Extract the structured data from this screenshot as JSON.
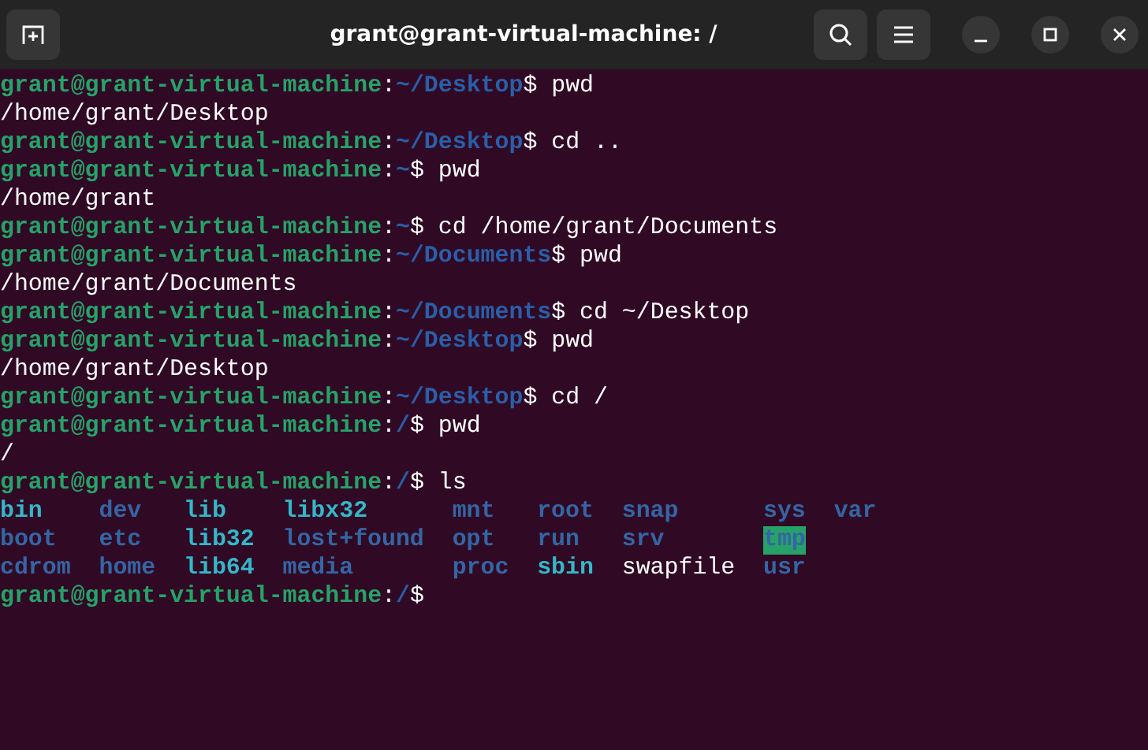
{
  "window": {
    "title": "grant@grant-virtual-machine: /"
  },
  "lines": [
    {
      "kind": "prompt",
      "user": "grant@grant-virtual-machine",
      "sep": ":",
      "path": "~/Desktop",
      "dollar": "$",
      "command": "pwd"
    },
    {
      "kind": "output",
      "text": "/home/grant/Desktop"
    },
    {
      "kind": "prompt",
      "user": "grant@grant-virtual-machine",
      "sep": ":",
      "path": "~/Desktop",
      "dollar": "$",
      "command": "cd .."
    },
    {
      "kind": "prompt",
      "user": "grant@grant-virtual-machine",
      "sep": ":",
      "path": "~",
      "dollar": "$",
      "command": "pwd"
    },
    {
      "kind": "output",
      "text": "/home/grant"
    },
    {
      "kind": "prompt",
      "user": "grant@grant-virtual-machine",
      "sep": ":",
      "path": "~",
      "dollar": "$",
      "command": "cd /home/grant/Documents"
    },
    {
      "kind": "prompt",
      "user": "grant@grant-virtual-machine",
      "sep": ":",
      "path": "~/Documents",
      "dollar": "$",
      "command": "pwd"
    },
    {
      "kind": "output",
      "text": "/home/grant/Documents"
    },
    {
      "kind": "prompt",
      "user": "grant@grant-virtual-machine",
      "sep": ":",
      "path": "~/Documents",
      "dollar": "$",
      "command": "cd ~/Desktop"
    },
    {
      "kind": "prompt",
      "user": "grant@grant-virtual-machine",
      "sep": ":",
      "path": "~/Desktop",
      "dollar": "$",
      "command": "pwd"
    },
    {
      "kind": "output",
      "text": "/home/grant/Desktop"
    },
    {
      "kind": "prompt",
      "user": "grant@grant-virtual-machine",
      "sep": ":",
      "path": "~/Desktop",
      "dollar": "$",
      "command": "cd /"
    },
    {
      "kind": "prompt",
      "user": "grant@grant-virtual-machine",
      "sep": ":",
      "path": "/",
      "dollar": "$",
      "command": "pwd"
    },
    {
      "kind": "output",
      "text": "/"
    },
    {
      "kind": "prompt",
      "user": "grant@grant-virtual-machine",
      "sep": ":",
      "path": "/",
      "dollar": "$",
      "command": "ls"
    },
    {
      "kind": "listing",
      "columns": [
        [
          {
            "name": "bin",
            "kind": "link"
          },
          {
            "name": "boot",
            "kind": "dir"
          },
          {
            "name": "cdrom",
            "kind": "dir"
          }
        ],
        [
          {
            "name": "dev",
            "kind": "dir"
          },
          {
            "name": "etc",
            "kind": "dir"
          },
          {
            "name": "home",
            "kind": "dir"
          }
        ],
        [
          {
            "name": "lib",
            "kind": "link"
          },
          {
            "name": "lib32",
            "kind": "link"
          },
          {
            "name": "lib64",
            "kind": "link"
          }
        ],
        [
          {
            "name": "libx32",
            "kind": "link"
          },
          {
            "name": "lost+found",
            "kind": "dir"
          },
          {
            "name": "media",
            "kind": "dir"
          }
        ],
        [
          {
            "name": "mnt",
            "kind": "dir"
          },
          {
            "name": "opt",
            "kind": "dir"
          },
          {
            "name": "proc",
            "kind": "dir"
          }
        ],
        [
          {
            "name": "root",
            "kind": "dir"
          },
          {
            "name": "run",
            "kind": "dir"
          },
          {
            "name": "sbin",
            "kind": "link"
          }
        ],
        [
          {
            "name": "snap",
            "kind": "dir"
          },
          {
            "name": "srv",
            "kind": "dir"
          },
          {
            "name": "swapfile",
            "kind": "file"
          }
        ],
        [
          {
            "name": "sys",
            "kind": "dir"
          },
          {
            "name": "tmp",
            "kind": "sticky"
          },
          {
            "name": "usr",
            "kind": "dir"
          }
        ],
        [
          {
            "name": "var",
            "kind": "dir"
          }
        ]
      ]
    },
    {
      "kind": "prompt",
      "user": "grant@grant-virtual-machine",
      "sep": ":",
      "path": "/",
      "dollar": "$"
    }
  ]
}
